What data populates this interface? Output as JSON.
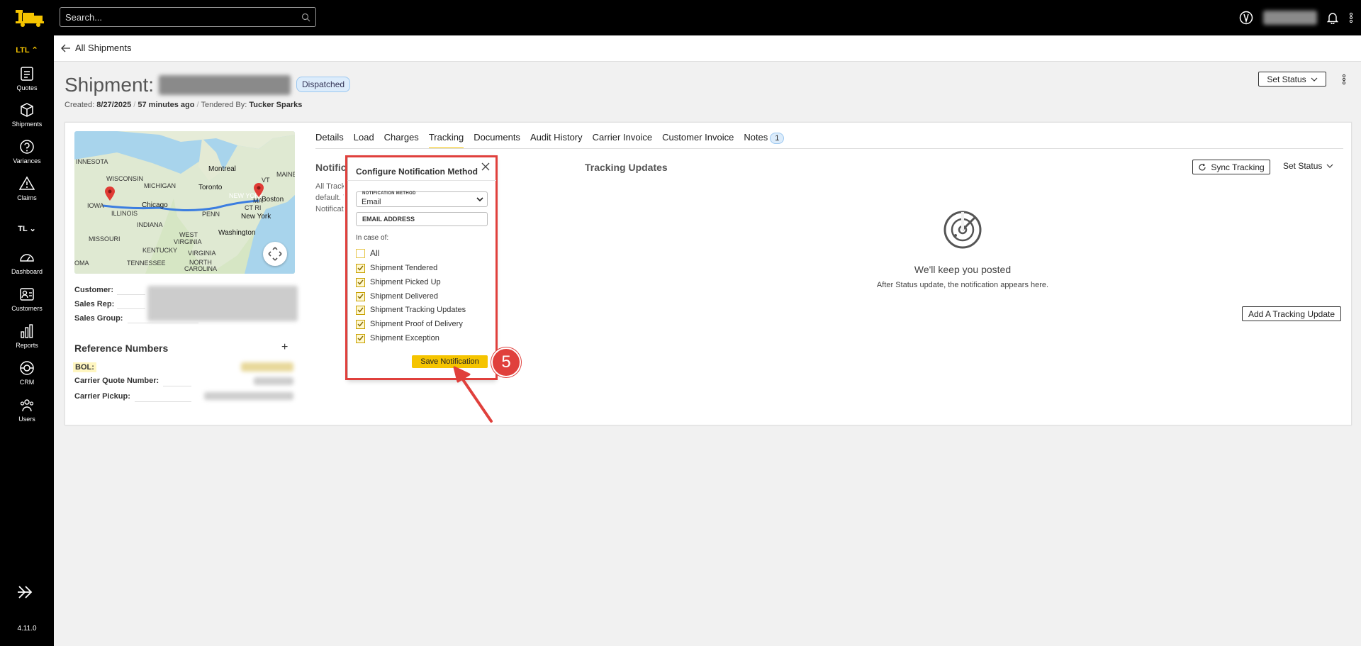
{
  "topbar": {
    "search_placeholder": "Search..."
  },
  "sidebar": {
    "group1": "LTL",
    "group2": "TL",
    "items": [
      {
        "label": "Quotes",
        "icon": "quotes-icon"
      },
      {
        "label": "Shipments",
        "icon": "box-icon"
      },
      {
        "label": "Variances",
        "icon": "question-icon"
      },
      {
        "label": "Claims",
        "icon": "warning-icon"
      },
      {
        "label": "Dashboard",
        "icon": "gauge-icon"
      },
      {
        "label": "Customers",
        "icon": "contact-icon"
      },
      {
        "label": "Reports",
        "icon": "bar-chart-icon"
      },
      {
        "label": "CRM",
        "icon": "crm-icon"
      },
      {
        "label": "Users",
        "icon": "users-icon"
      }
    ],
    "version": "4.11.0"
  },
  "header": {
    "breadcrumb": "All Shipments",
    "title": "Shipment:",
    "status": "Dispatched",
    "created_label": "Created:",
    "created_value": "8/27/2025",
    "age": "57 minutes ago",
    "tendered_label": "Tendered By:",
    "tendered_value": "Tucker Sparks",
    "set_status": "Set Status"
  },
  "map": {
    "labels": [
      "INNESOTA",
      "WISCONSIN",
      "MICHIGAN",
      "Montreal",
      "MAINE",
      "VT",
      "Toronto",
      "NEW YORK",
      "Boston",
      "IOWA",
      "Chicago",
      "ILLINOIS",
      "INDIANA",
      "PENN",
      "CT RI",
      "New York",
      "MA",
      "MISSOURI",
      "WEST",
      "VIRGINIA",
      "Washington",
      "KENTUCKY",
      "VIRGINIA",
      "TENNESSEE",
      "NORTH",
      "CAROLINA",
      "OMA"
    ]
  },
  "info": {
    "customer": "Customer:",
    "sales_rep": "Sales Rep:",
    "sales_group": "Sales Group:"
  },
  "reference": {
    "title": "Reference Numbers",
    "bol": "BOL:",
    "carrier_quote": "Carrier Quote Number:",
    "carrier_pickup": "Carrier Pickup:"
  },
  "tabs": [
    "Details",
    "Load",
    "Charges",
    "Tracking",
    "Documents",
    "Audit History",
    "Carrier Invoice",
    "Customer Invoice",
    "Notes"
  ],
  "notes_count": "1",
  "notifications": {
    "title": "Notific",
    "desc_lines": [
      "All Track",
      "default. Y",
      "Notificat"
    ]
  },
  "tracking": {
    "title": "Tracking Updates",
    "sync": "Sync Tracking",
    "set_status": "Set Status",
    "empty_title": "We'll keep you posted",
    "empty_desc": "After Status update, the notification appears here.",
    "add_update": "Add A Tracking Update"
  },
  "popup": {
    "title": "Configure Notification Method",
    "method_label": "NOTIFICATION METHOD",
    "method_value": "Email",
    "email_label": "EMAIL ADDRESS",
    "in_case": "In case of:",
    "options": [
      {
        "label": "All",
        "checked": false
      },
      {
        "label": "Shipment Tendered",
        "checked": true
      },
      {
        "label": "Shipment Picked Up",
        "checked": true
      },
      {
        "label": "Shipment Delivered",
        "checked": true
      },
      {
        "label": "Shipment Tracking Updates",
        "checked": true
      },
      {
        "label": "Shipment Proof of Delivery",
        "checked": true
      },
      {
        "label": "Shipment Exception",
        "checked": true
      }
    ],
    "save": "Save Notification"
  },
  "annotation": {
    "step": "5"
  },
  "colors": {
    "accent": "#f5c400",
    "callout": "#e0403c",
    "badge_bg": "#dcecfb"
  }
}
